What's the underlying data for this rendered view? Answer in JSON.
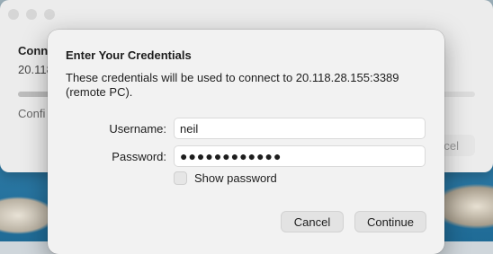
{
  "background_window": {
    "title": "Conn",
    "subtitle": "20.118",
    "status": "Confi",
    "cancel_label": "cel"
  },
  "dialog": {
    "title": "Enter Your Credentials",
    "description": "These credentials will be used to connect to 20.118.28.155:3389 (remote PC).",
    "username_label": "Username:",
    "username_value": "neil",
    "password_label": "Password:",
    "password_dots": "●●●●●●●●●●●●",
    "show_password_label": "Show password",
    "show_password_checked": false,
    "cancel_label": "Cancel",
    "continue_label": "Continue"
  },
  "icons": {
    "traffic_lights": [
      "close-icon",
      "minimize-icon",
      "zoom-icon"
    ]
  }
}
